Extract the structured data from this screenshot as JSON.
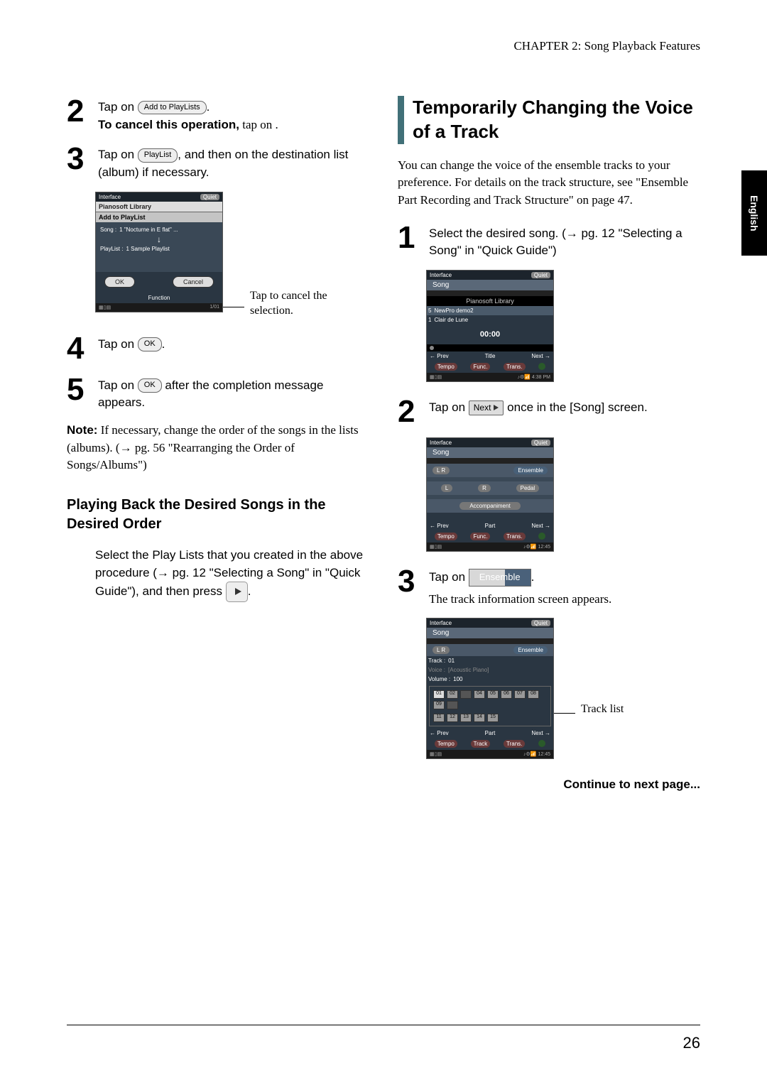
{
  "header": "CHAPTER 2: Song Playback Features",
  "lang_tab": "English",
  "left": {
    "step2": {
      "line1a": "Tap on ",
      "btn": "Add to PlayLists",
      "line1b": ".",
      "line2a": "To cancel this operation,",
      "line2b": " tap on               ."
    },
    "step3": {
      "line1a": "Tap on ",
      "btn": "PlayList",
      "line1b": ", and then on the destination list (album) if necessary."
    },
    "fig1": {
      "top_left": "Interface",
      "quiet": "Quiet",
      "lib": "Pianosoft Library",
      "addpl": "Add to PlayList",
      "song_lbl": "Song :",
      "song_name": "1  \"Nocturne in E flat\" ...",
      "pl_lbl": "PlayList :",
      "pl_name": "1 Sample Playlist",
      "ok": "OK",
      "cancel": "Cancel",
      "func": "Function",
      "btm": "1/01"
    },
    "callout1": "Tap to cancel the selection.",
    "step4": {
      "text_a": "Tap on ",
      "btn": "OK",
      "text_b": "."
    },
    "step5": {
      "text_a": "Tap on ",
      "btn": "OK",
      "text_b": " after the completion message appears."
    },
    "note_label": "Note:",
    "note_text": " If necessary, change the order of the songs in the lists (albums). (→ pg. 56 \"Rearranging the Order of Songs/Albums\")",
    "sub1": "Playing Back the Desired Songs in the Desired Order",
    "sub1_body_a": "Select the Play Lists that you created in the above procedure (→ pg. 12 \"Selecting a Song\" in \"Quick Guide\"), and then press ",
    "sub1_body_b": "."
  },
  "right": {
    "heading": "Temporarily Changing the Voice of a Track",
    "intro": "You can change the voice of the ensemble tracks to your preference. For details on the track structure, see \"Ensemble Part Recording and Track Structure\" on page 47.",
    "step1": "Select the desired song. (→ pg. 12 \"Selecting a Song\" in \"Quick Guide\")",
    "fig2": {
      "top_left": "Interface",
      "quiet": "Quiet",
      "song": "Song",
      "lib": "Pianosoft Library",
      "r1_n": "5",
      "r1": "NewPro demo2",
      "r2_n": "1",
      "r2": "Clair de Lune",
      "time": "00:00",
      "prev": "← Prev",
      "title": "Title",
      "next": "Next →",
      "b1": "Tempo",
      "b2": "Func.",
      "b3": "Trans."
    },
    "step2_a": "Tap on ",
    "step2_btn": "Next",
    "step2_b": " once in the [Song] screen.",
    "fig3": {
      "top_left": "Interface",
      "quiet": "Quiet",
      "song": "Song",
      "lr": "L  R",
      "ens": "Ensemble",
      "l": "L",
      "r": "R",
      "pedal": "Pedal",
      "acc": "Accompaniment",
      "prev": "← Prev",
      "part": "Part",
      "next": "Next →",
      "b1": "Tempo",
      "b2": "Func.",
      "b3": "Trans."
    },
    "step3_a": "Tap on ",
    "step3_btn": "Ensemble",
    "step3_b": ".",
    "step3_sub": "The track information screen appears.",
    "fig4": {
      "top_left": "Interface",
      "quiet": "Quiet",
      "song": "Song",
      "lr": "L R",
      "ens": "Ensemble",
      "track_lbl": "Track :",
      "track_val": "01",
      "voice_lbl": "Voice :",
      "voice_val": "[Acoustic Piano]",
      "vol_lbl": "Volume :",
      "vol_val": "100",
      "grid_r1": [
        "01",
        "02",
        "",
        "04",
        "05",
        "06",
        "07",
        "08",
        "09",
        ""
      ],
      "grid_r2": [
        "11",
        "12",
        "13",
        "14",
        "15"
      ],
      "prev": "← Prev",
      "part": "Part",
      "next": "Next →",
      "b1": "Tempo",
      "b2": "Track",
      "b3": "Trans."
    },
    "callout2": "Track list",
    "continue": "Continue to next page..."
  },
  "page_number": "26"
}
